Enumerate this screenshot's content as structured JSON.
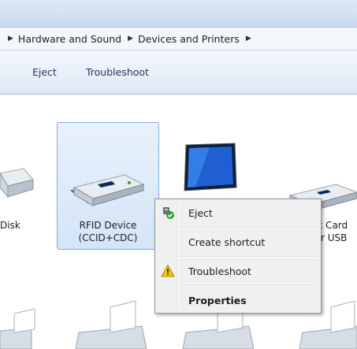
{
  "breadcrumb": {
    "items": [
      "Hardware and Sound",
      "Devices and Printers"
    ]
  },
  "toolbar": {
    "eject_label": "Eject",
    "troubleshoot_label": "Troubleshoot"
  },
  "devices": {
    "left_disk": "Disk",
    "rfid_line1": "RFID Device",
    "rfid_line2": "(CCID+CDC)",
    "right_line1": "urt Card",
    "right_line2": "der USB"
  },
  "context_menu": {
    "items": [
      {
        "label": "Eject",
        "icon": "eject-icon"
      },
      {
        "label": "Create shortcut"
      },
      {
        "label": "Troubleshoot",
        "icon": "warning-icon"
      },
      {
        "label": "Properties",
        "bold": true
      }
    ]
  },
  "colors": {
    "selection_fill": "#d4e5f7",
    "selection_border": "#84acdd",
    "menu_bg": "#f0f0f0"
  }
}
